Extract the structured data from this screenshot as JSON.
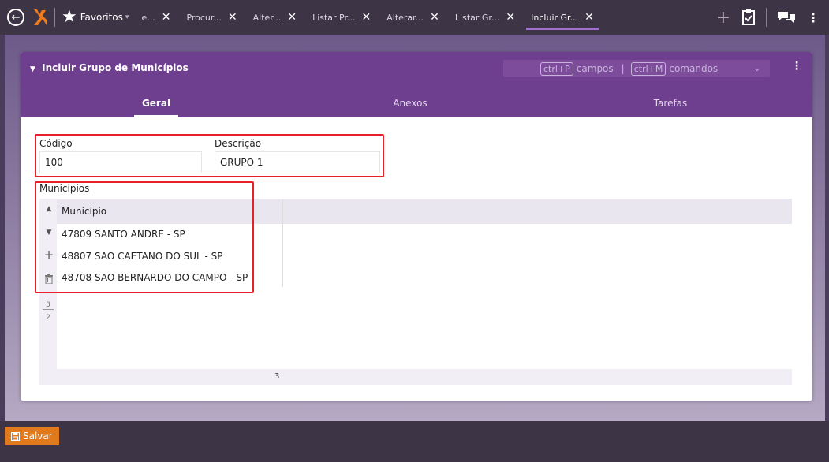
{
  "topbar": {
    "favorites_label": "Favoritos",
    "tabs": [
      {
        "label": "e...",
        "active": false
      },
      {
        "label": "Procur...",
        "active": false
      },
      {
        "label": "Alter...",
        "active": false
      },
      {
        "label": "Listar Pr...",
        "active": false
      },
      {
        "label": "Alterar...",
        "active": false
      },
      {
        "label": "Listar Gr...",
        "active": false
      },
      {
        "label": "Incluir Gr...",
        "active": true
      }
    ],
    "close_glyph": "✕"
  },
  "panel": {
    "title": "Incluir Grupo de Municípios",
    "shortcut_fields_key": "ctrl+P",
    "shortcut_fields_label": "campos",
    "shortcut_commands_key": "ctrl+M",
    "shortcut_commands_label": "comandos",
    "tabs": [
      {
        "label": "Geral",
        "active": true
      },
      {
        "label": "Anexos",
        "active": false
      },
      {
        "label": "Tarefas",
        "active": false
      }
    ]
  },
  "form": {
    "codigo_label": "Código",
    "codigo_value": "100",
    "descricao_label": "Descrição",
    "descricao_value": "GRUPO 1",
    "municipios_label": "Municípios"
  },
  "grid": {
    "column_header": "Município",
    "rows": [
      "47809 SANTO ANDRE - SP",
      "48807 SAO CAETANO DO SUL - SP",
      "48708 SAO BERNARDO DO CAMPO - SP"
    ],
    "pager_top": "3",
    "pager_bottom": "2",
    "footer_count": "3"
  },
  "bottombar": {
    "save_label": "Salvar"
  },
  "colors": {
    "brand_purple": "#6f3f8f",
    "highlight_red": "#e8202a",
    "save_orange": "#e07a1c"
  }
}
